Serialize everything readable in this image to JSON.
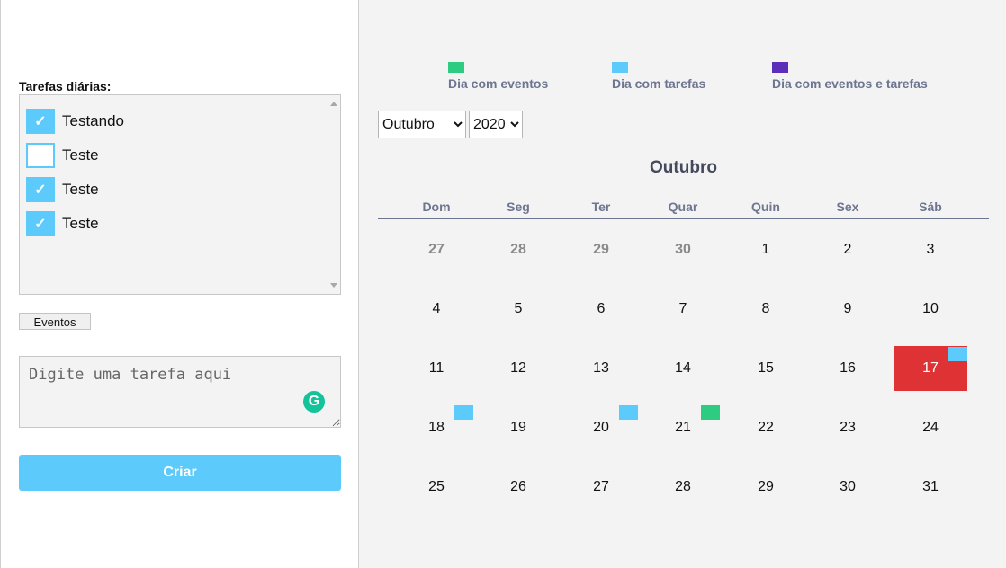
{
  "sidebar": {
    "tasks_label": "Tarefas diárias:",
    "tasks": [
      {
        "label": "Testando",
        "checked": true
      },
      {
        "label": "Teste",
        "checked": false
      },
      {
        "label": "Teste",
        "checked": true
      },
      {
        "label": "Teste",
        "checked": true
      }
    ],
    "events_button": "Eventos",
    "task_input_placeholder": "Digite uma tarefa aqui",
    "create_button": "Criar"
  },
  "legend": [
    {
      "label": "Dia com eventos",
      "color": "#2ecc80"
    },
    {
      "label": "Dia com tarefas",
      "color": "#5ccbfb"
    },
    {
      "label": "Dia com eventos e tarefas",
      "color": "#5b2fb8"
    }
  ],
  "controls": {
    "month_selected": "Outubro",
    "year_selected": "2020"
  },
  "calendar": {
    "title": "Outubro",
    "weekdays": [
      "Dom",
      "Seg",
      "Ter",
      "Quar",
      "Quin",
      "Sex",
      "Sáb"
    ],
    "weeks": [
      [
        {
          "d": "27",
          "prev": true
        },
        {
          "d": "28",
          "prev": true
        },
        {
          "d": "29",
          "prev": true
        },
        {
          "d": "30",
          "prev": true
        },
        {
          "d": "1"
        },
        {
          "d": "2"
        },
        {
          "d": "3"
        }
      ],
      [
        {
          "d": "4"
        },
        {
          "d": "5"
        },
        {
          "d": "6"
        },
        {
          "d": "7"
        },
        {
          "d": "8"
        },
        {
          "d": "9"
        },
        {
          "d": "10"
        }
      ],
      [
        {
          "d": "11"
        },
        {
          "d": "12"
        },
        {
          "d": "13"
        },
        {
          "d": "14"
        },
        {
          "d": "15"
        },
        {
          "d": "16"
        },
        {
          "d": "17",
          "today": true,
          "marker": "tarefas"
        }
      ],
      [
        {
          "d": "18",
          "marker": "tarefas"
        },
        {
          "d": "19"
        },
        {
          "d": "20",
          "marker": "tarefas"
        },
        {
          "d": "21",
          "marker": "eventos"
        },
        {
          "d": "22"
        },
        {
          "d": "23"
        },
        {
          "d": "24"
        }
      ],
      [
        {
          "d": "25"
        },
        {
          "d": "26"
        },
        {
          "d": "27"
        },
        {
          "d": "28"
        },
        {
          "d": "29"
        },
        {
          "d": "30"
        },
        {
          "d": "31"
        }
      ]
    ],
    "colors": {
      "today": "#de3234",
      "tarefas": "#5ccbfb",
      "eventos": "#2ecc80",
      "ambos": "#5b2fb8"
    }
  }
}
